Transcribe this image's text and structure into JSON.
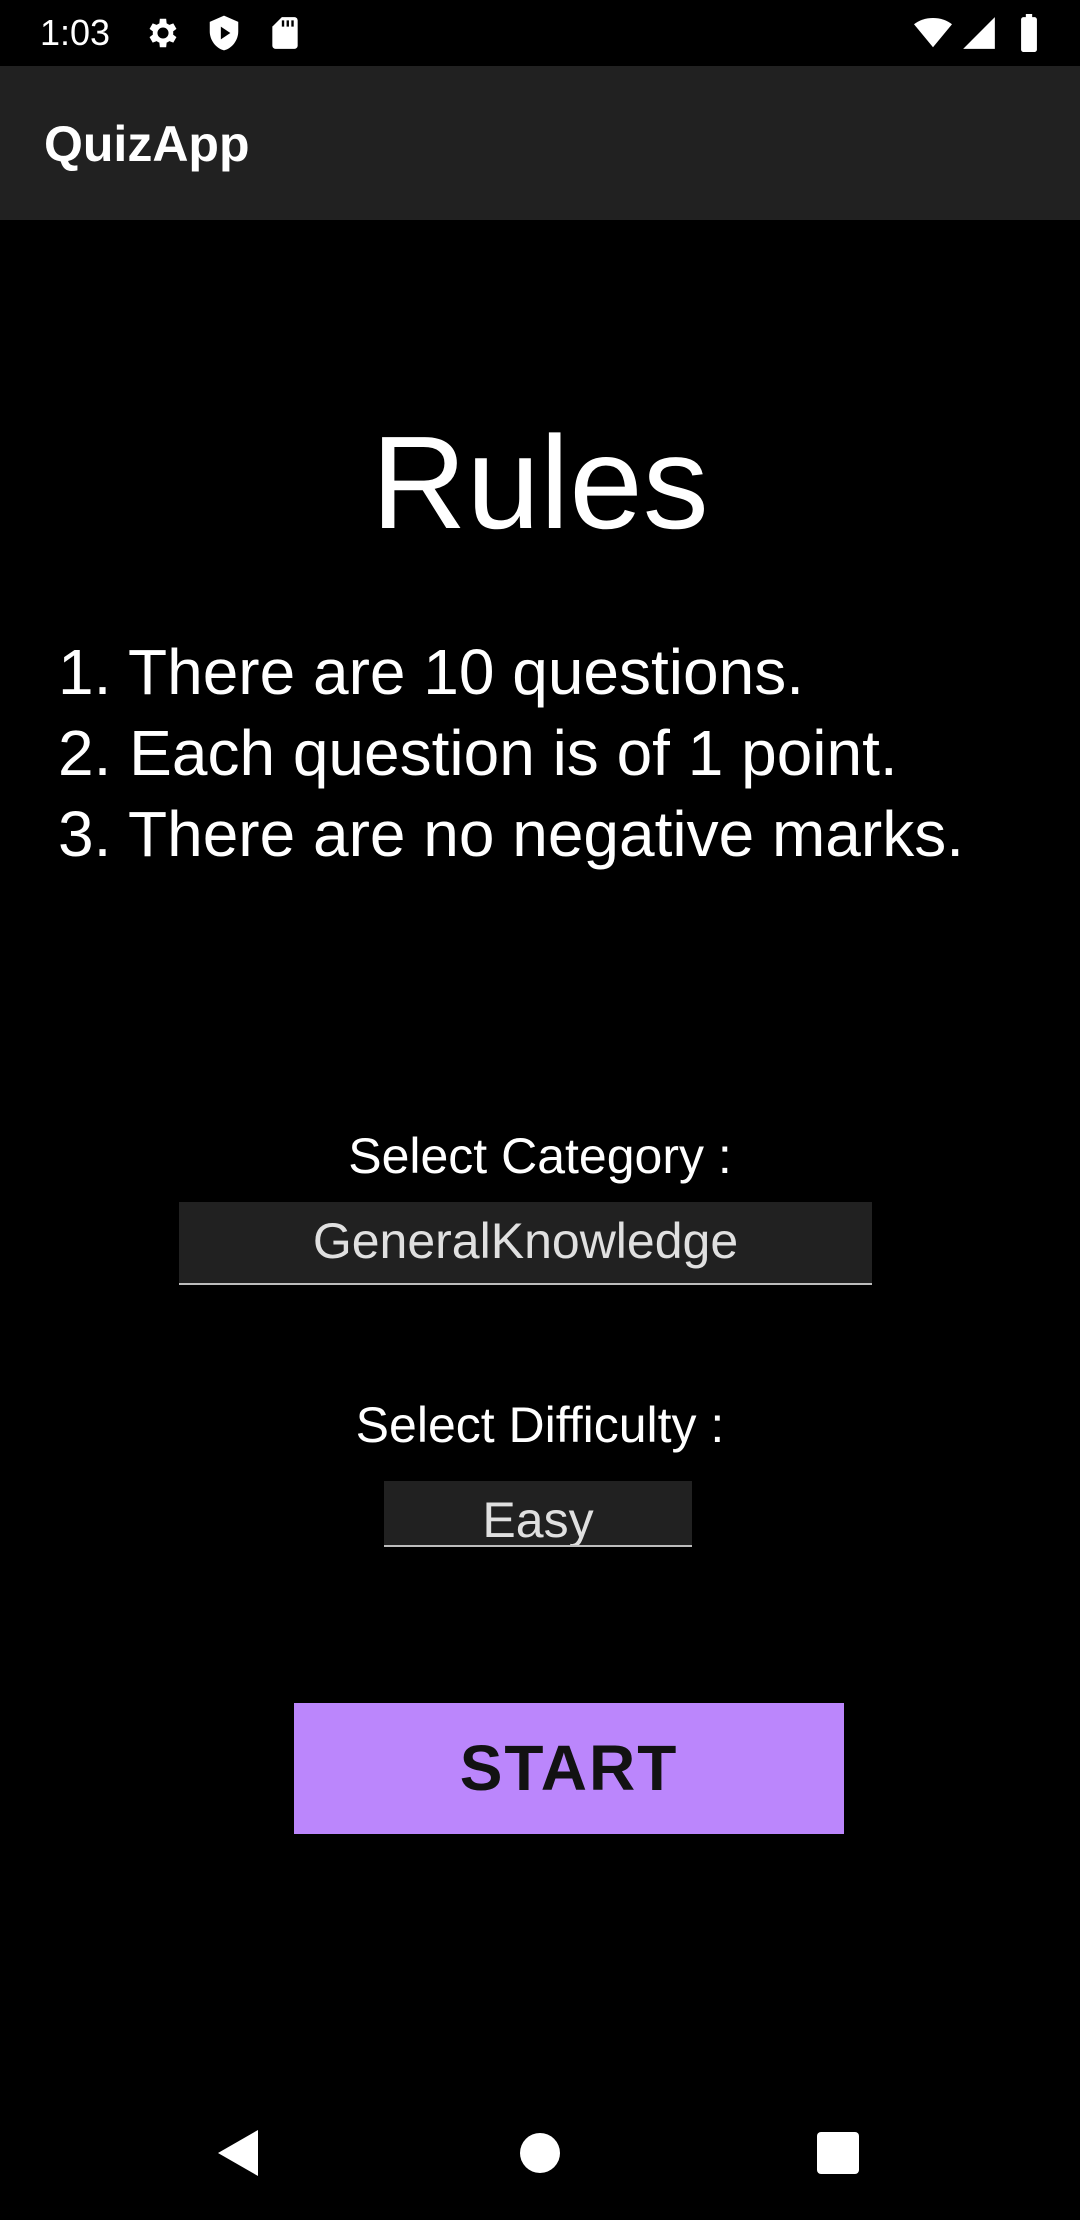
{
  "status_bar": {
    "time": "1:03",
    "left_icons": [
      "gear-icon",
      "shield-play-icon",
      "sd-card-icon"
    ],
    "right_icons": [
      "wifi-icon",
      "cell-signal-icon",
      "battery-icon"
    ]
  },
  "app_bar": {
    "title": "QuizApp"
  },
  "rules": {
    "heading": "Rules",
    "items": [
      "1. There are 10 questions.",
      "2. Each question is of 1 point.",
      "3. There are no negative marks."
    ]
  },
  "category": {
    "label": "Select Category :",
    "selected": "GeneralKnowledge"
  },
  "difficulty": {
    "label": "Select Difficulty :",
    "selected": "Easy"
  },
  "start_button": {
    "label": "START"
  },
  "nav_bar": {
    "buttons": [
      "back-icon",
      "home-icon",
      "recents-icon"
    ]
  },
  "colors": {
    "background": "#000000",
    "app_bar": "#212121",
    "accent": "#bb86fc",
    "text": "#ffffff"
  }
}
